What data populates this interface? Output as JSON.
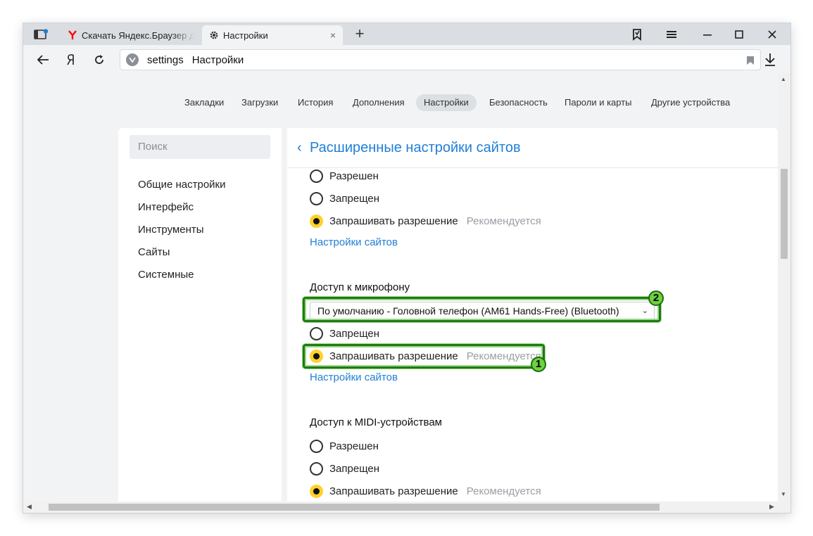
{
  "tabs": {
    "inactive_title": "Скачать Яндекс.Браузер для компьютера",
    "active_title": "Настройки",
    "close_symbol": "×",
    "new_tab_symbol": "+"
  },
  "address": {
    "url": "settings",
    "page_title": "Настройки"
  },
  "topnav": {
    "items": [
      "Закладки",
      "Загрузки",
      "История",
      "Дополнения",
      "Настройки",
      "Безопасность",
      "Пароли и карты",
      "Другие устройства"
    ],
    "active": "Настройки"
  },
  "sidebar": {
    "search_placeholder": "Поиск",
    "items": [
      "Общие настройки",
      "Интерфейс",
      "Инструменты",
      "Сайты",
      "Системные"
    ]
  },
  "main": {
    "title": "Расширенные настройки сайтов",
    "block1": {
      "options": [
        "Разрешен",
        "Запрещен",
        "Запрашивать разрешение"
      ],
      "recommended": "Рекомендуется",
      "link": "Настройки сайтов"
    },
    "microphone": {
      "title": "Доступ к микрофону",
      "device_select": "По умолчанию - Головной телефон (AM61 Hands-Free) (Bluetooth)",
      "options": [
        "Запрещен",
        "Запрашивать разрешение"
      ],
      "recommended": "Рекомендуется",
      "link": "Настройки сайтов"
    },
    "midi": {
      "title": "Доступ к MIDI-устройствам",
      "options": [
        "Разрешен",
        "Запрещен",
        "Запрашивать разрешение"
      ],
      "recommended": "Рекомендуется"
    }
  },
  "annotations": {
    "badge1": "1",
    "badge2": "2",
    "highlight_color": "#1f7a12",
    "badge_color": "#6fd13f"
  },
  "colors": {
    "accent": "#1f7fd6",
    "radio_checked": "#ffd12a",
    "yandex_red": "#ff0000"
  }
}
